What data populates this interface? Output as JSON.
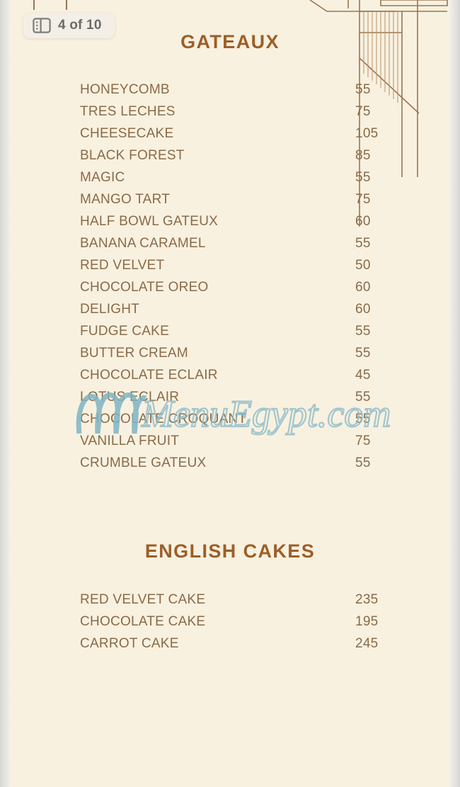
{
  "viewer": {
    "page_indicator": "4 of 10",
    "page_icon": "page-spread-icon"
  },
  "colors": {
    "background": "#f8f1e0",
    "heading": "#9c5f28",
    "item_text": "#8a6a47",
    "deco_line": "#9a7550",
    "watermark": "#7fb4c4",
    "badge_text": "#6b6b6b",
    "badge_bg": "#f3efe6",
    "gutter": "#d5d6d2"
  },
  "watermark": {
    "text": "MenuEgypt.com",
    "logo": "swirl-logo-icon"
  },
  "sections": [
    {
      "title": "GATEAUX",
      "items": [
        {
          "name": "HONEYCOMB",
          "price": "55"
        },
        {
          "name": "TRES LECHES",
          "price": "75"
        },
        {
          "name": "CHEESECAKE",
          "price": "105"
        },
        {
          "name": "BLACK FOREST",
          "price": "85"
        },
        {
          "name": "MAGIC",
          "price": "55"
        },
        {
          "name": "MANGO TART",
          "price": "75"
        },
        {
          "name": "HALF BOWL GATEUX",
          "price": "60"
        },
        {
          "name": "BANANA CARAMEL",
          "price": "55"
        },
        {
          "name": "RED VELVET",
          "price": "50"
        },
        {
          "name": "CHOCOLATE OREO",
          "price": "60"
        },
        {
          "name": "DELIGHT",
          "price": "60"
        },
        {
          "name": "FUDGE CAKE",
          "price": "55"
        },
        {
          "name": "BUTTER CREAM",
          "price": "55"
        },
        {
          "name": "CHOCOLATE ECLAIR",
          "price": "45"
        },
        {
          "name": "LOTUS ECLAIR",
          "price": "55"
        },
        {
          "name": "CHOCOLATE CROQUANT",
          "price": "55"
        },
        {
          "name": "VANILLA FRUIT",
          "price": "75"
        },
        {
          "name": "CRUMBLE GATEUX",
          "price": "55"
        }
      ]
    },
    {
      "title": "ENGLISH CAKES",
      "items": [
        {
          "name": "RED VELVET CAKE",
          "price": "235"
        },
        {
          "name": "CHOCOLATE CAKE",
          "price": "195"
        },
        {
          "name": "CARROT CAKE",
          "price": "245"
        }
      ]
    }
  ]
}
